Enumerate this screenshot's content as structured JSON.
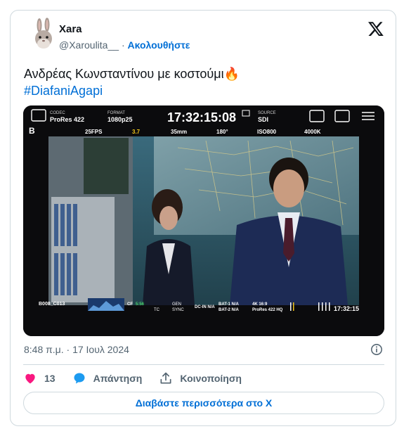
{
  "author": {
    "name": "Xara",
    "handle": "@Xaroulita__",
    "separator": "·",
    "follow_label": "Ακολουθήστε"
  },
  "tweet": {
    "text": "Ανδρέας Κωνσταντίνου με κοστούμι",
    "emoji": "🔥",
    "hashtag": "#DiafaniAgapi",
    "timestamp": "8:48 π.μ. · 17 Ιουλ 2024"
  },
  "camera_hud": {
    "codec_label": "CODEC",
    "codec_value": "ProRes 422",
    "format_label": "FORMAT",
    "format_value": "1080p25",
    "timecode": "17:32:15:08",
    "source_label": "SOURCE",
    "source_value": "SDI",
    "channel": "B",
    "fps": "25FPS",
    "iris": "3.7",
    "lens": "35mm",
    "shutter": "180°",
    "iso": "ISO800",
    "white_balance": "4000K",
    "clip_name": "B008_C013",
    "cf": "CF",
    "cf_value": "5:56",
    "tc_label": "TC",
    "gen_label": "GEN",
    "sync_label": "SYNC",
    "dc_in": "DC-IN N/A",
    "bat1": "BAT-1 N/A",
    "bat2": "BAT-2 N/A",
    "res1": "4K 16:9",
    "res2": "ProRes 422 HQ",
    "timecode_short": "17:32:15"
  },
  "actions": {
    "likes": "13",
    "reply_label": "Απάντηση",
    "share_label": "Κοινοποίηση"
  },
  "read_more_label": "Διαβάστε περισσότερα στο X",
  "colors": {
    "link": "#006fd6",
    "like": "#f91880",
    "reply": "#1d9bf0",
    "border": "#cfd9de"
  },
  "icons": [
    "rabbit-avatar",
    "x-logo-icon",
    "info-icon",
    "heart-icon",
    "reply-bubble-icon",
    "share-icon"
  ]
}
